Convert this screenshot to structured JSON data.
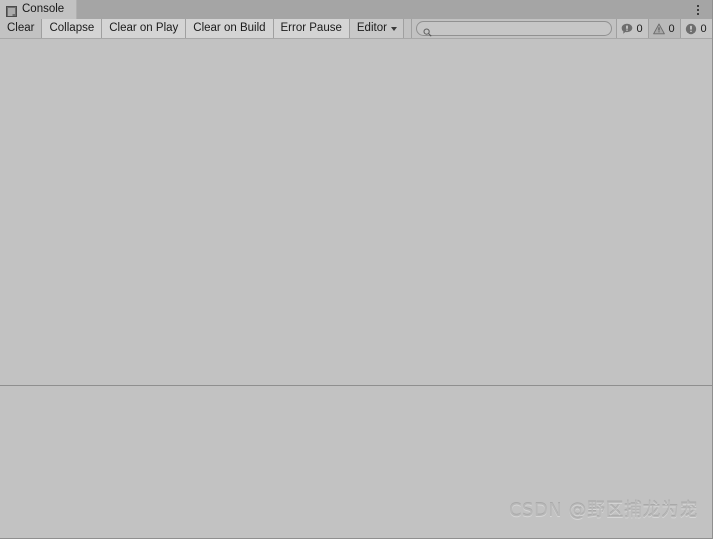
{
  "window": {
    "tab": {
      "icon": "console-icon",
      "label": "Console"
    },
    "menu_icon": "kebab-menu-icon"
  },
  "toolbar": {
    "buttons": [
      {
        "label": "Clear",
        "name": "clear-button"
      },
      {
        "label": "Collapse",
        "name": "collapse-button"
      },
      {
        "label": "Clear on Play",
        "name": "clear-on-play-button"
      },
      {
        "label": "Clear on Build",
        "name": "clear-on-build-button"
      },
      {
        "label": "Error Pause",
        "name": "error-pause-button"
      }
    ],
    "dropdown": {
      "label": "Editor",
      "icon": "chevron-down-icon"
    },
    "search": {
      "value": "",
      "placeholder": "",
      "icon": "search-icon"
    },
    "counters": [
      {
        "icon": "log-message-icon",
        "count": "0",
        "name": "log-count"
      },
      {
        "icon": "warning-triangle-icon",
        "count": "0",
        "name": "warning-count"
      },
      {
        "icon": "error-circle-icon",
        "count": "0",
        "name": "error-count"
      }
    ]
  },
  "panes": {
    "message_list": {
      "items": []
    },
    "detail": {
      "text": ""
    }
  },
  "watermark": {
    "text": "CSDN @野区捕龙为宠"
  },
  "colors": {
    "window_bg": "#c2c2c2",
    "tabstrip_bg": "#a5a5a5",
    "button_bg": "#d4d4d4",
    "border": "#8f8f8f",
    "text": "#1b1b1b"
  }
}
